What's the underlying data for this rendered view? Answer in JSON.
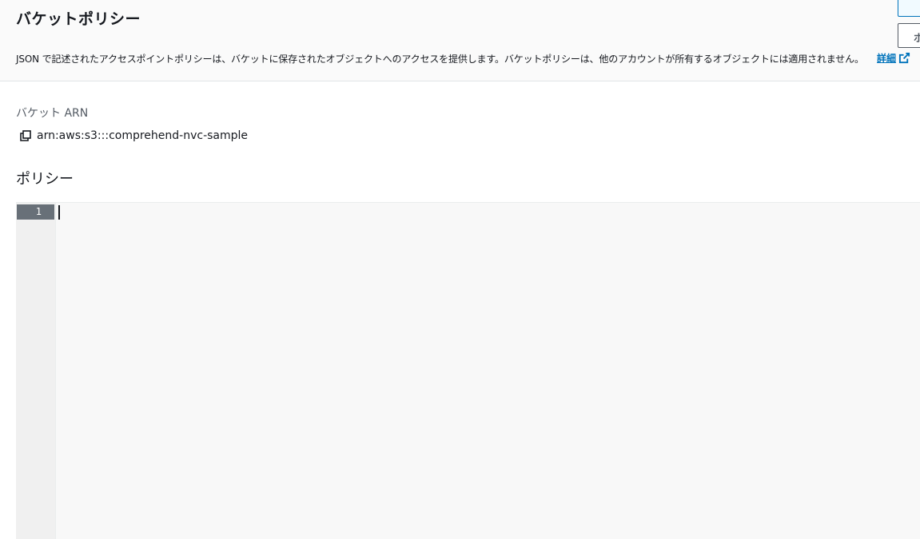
{
  "header": {
    "title": "バケットポリシー",
    "description": "JSON で記述されたアクセスポイントポリシーは、バケットに保存されたオブジェクトへのアクセスを提供します。バケットポリシーは、他のアカウントが所有するオブジェクトには適用されません。",
    "more_link": "詳細",
    "partial_button_label": "ポ"
  },
  "arn": {
    "label": "バケット ARN",
    "value": "arn:aws:s3:::comprehend-nvc-sample",
    "copy_icon": "copy-icon"
  },
  "policy": {
    "heading": "ポリシー",
    "editor": {
      "line_numbers": [
        "1"
      ],
      "content": ""
    }
  },
  "colors": {
    "link": "#0073bb",
    "active_line_bg": "#687078",
    "editor_bg": "#f8f8f8",
    "header_bg": "#fafafa"
  }
}
